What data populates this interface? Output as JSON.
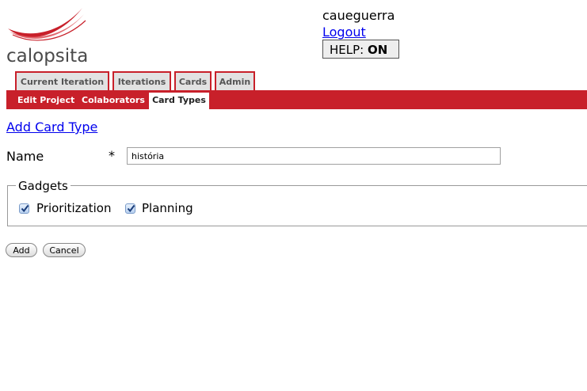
{
  "brand": {
    "name": "calopsita",
    "logo_icon": "swoosh-logo-icon",
    "accent_color": "#c8202a"
  },
  "user": {
    "username": "caueguerra",
    "logout_label": "Logout",
    "help_label": "HELP:",
    "help_state": "ON"
  },
  "tabs": [
    {
      "label": "Current Iteration"
    },
    {
      "label": "Iterations"
    },
    {
      "label": "Cards"
    },
    {
      "label": "Admin"
    }
  ],
  "subnav": {
    "items": [
      {
        "label": "Edit Project"
      },
      {
        "label": "Colaborators"
      },
      {
        "label": "Card Types"
      }
    ],
    "active": "Card Types"
  },
  "page": {
    "title_link": "Add Card Type"
  },
  "form": {
    "name_label": "Name",
    "required_marker": "*",
    "name_value": "história",
    "gadgets_legend": "Gadgets",
    "gadgets": [
      {
        "label": "Prioritization",
        "checked": true
      },
      {
        "label": "Planning",
        "checked": true
      }
    ],
    "add_button": "Add",
    "cancel_button": "Cancel"
  }
}
